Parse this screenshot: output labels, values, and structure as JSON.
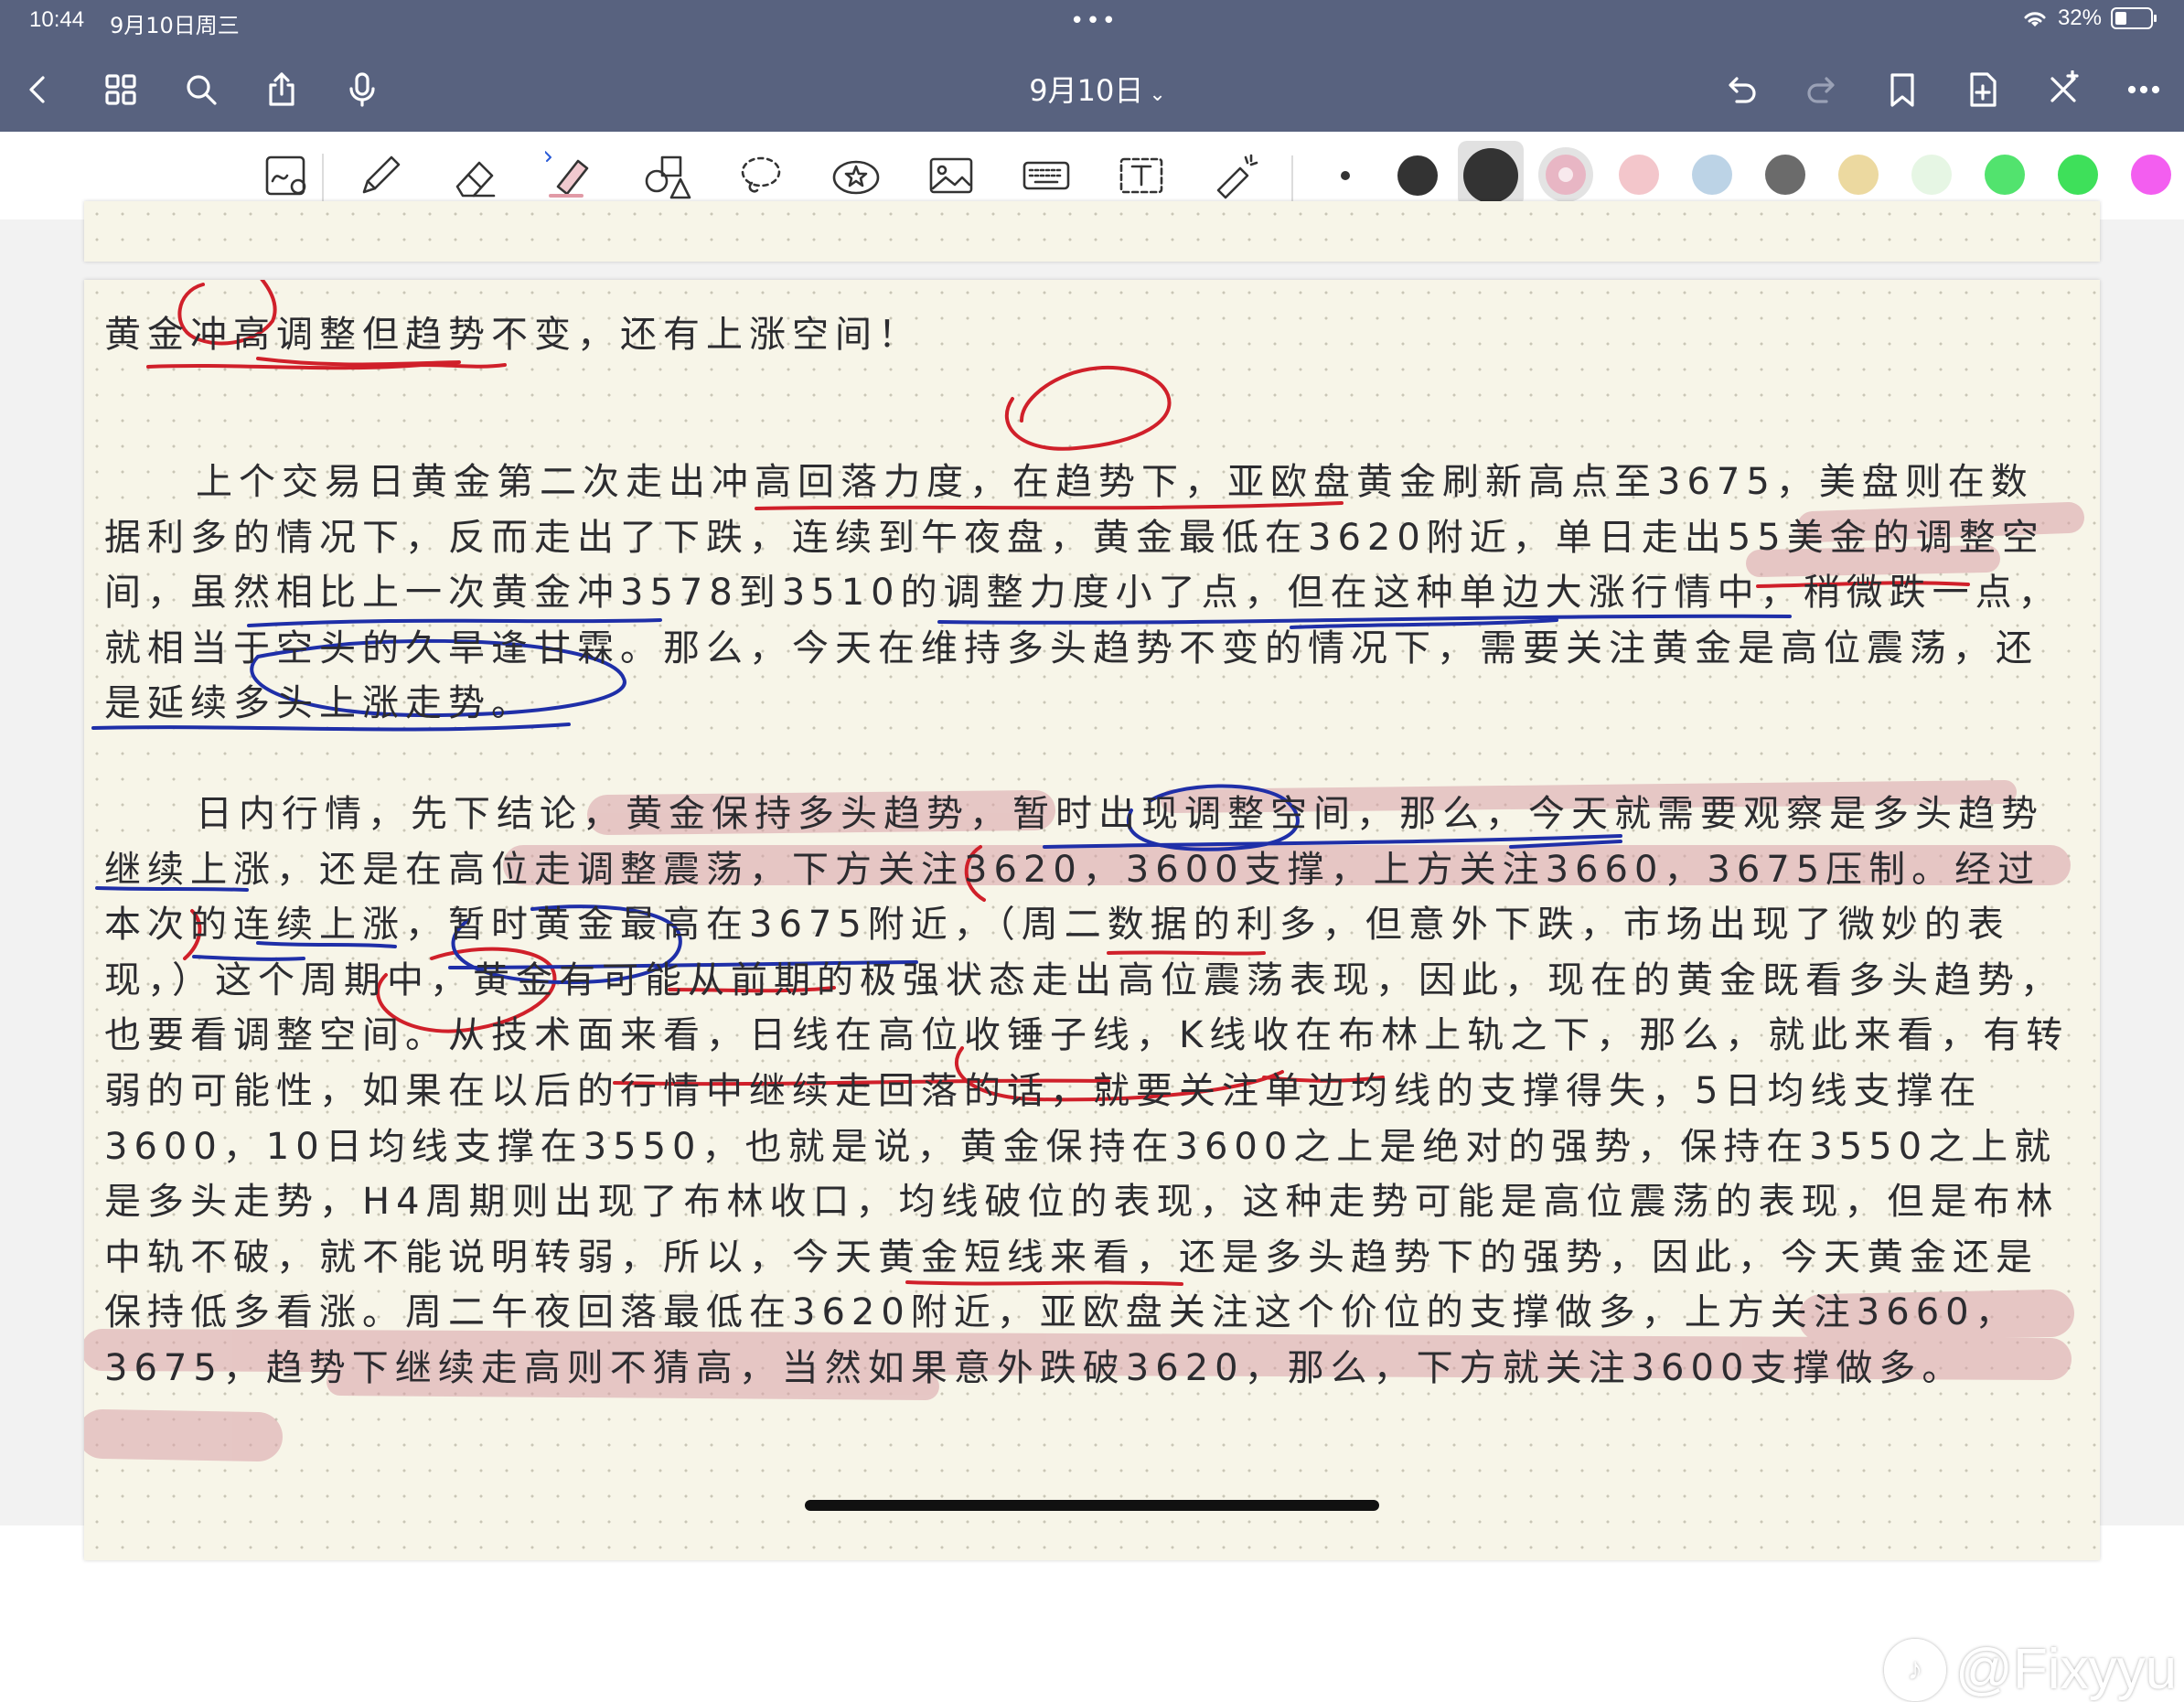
{
  "status_bar": {
    "time": "10:44",
    "date": "9月10日周三",
    "battery": "32%",
    "battery_level": 0.32,
    "multitask_dots": "•••"
  },
  "nav": {
    "title": "9月10日",
    "buttons": [
      "back-icon",
      "grid-icon",
      "search-icon",
      "share-icon",
      "microphone-icon",
      "undo-icon",
      "redo-icon",
      "bookmark-icon",
      "add-page-icon",
      "close-toolbar-icon",
      "more-icon"
    ]
  },
  "toolbar": {
    "tools": [
      "lasso-ai-icon",
      "pen-icon",
      "eraser-icon",
      "highlighter-icon",
      "shapes-icon",
      "lasso-icon",
      "sticker-icon",
      "image-icon",
      "keyboard-icon",
      "text-box-icon",
      "laser-pointer-icon"
    ],
    "stroke_sizes": [
      "small",
      "medium",
      "large"
    ],
    "selected_size": "large",
    "colors": [
      "#e8b6c4",
      "#f3c6cb",
      "#bcd3e6",
      "#6b6b6b",
      "#ecd9a0",
      "#e6f6e4",
      "#52e36e",
      "#3ee05a",
      "#f35ef0"
    ],
    "selected_color": "#e8b6c4"
  },
  "note": {
    "heading": "黄金冲高调整但趋势不变，还有上涨空间！",
    "paragraph1": "上个交易日黄金第二次走出冲高回落力度，在趋势下，亚欧盘黄金刷新高点至3675，美盘则在数据利多的情况下，反而走出了下跌，连续到午夜盘，黄金最低在3620附近，单日走出55美金的调整空间，虽然相比上一次黄金冲3578到3510的调整力度小了点，但在这种单边大涨行情中，稍微跌一点，就相当于空头的久旱逢甘霖。那么，今天在维持多头趋势不变的情况下，需要关注黄金是高位震荡，还是延续多头上涨走势。",
    "paragraph2": "日内行情，先下结论，黄金保持多头趋势，暂时出现调整空间，那么，今天就需要观察是多头趋势继续上涨，还是在高位走调整震荡，下方关注3620，3600支撑，上方关注3660，3675压制。经过本次的连续上涨，暂时黄金最高在3675附近，（周二数据的利多，但意外下跌，市场出现了微妙的表现，）这个周期中，黄金有可能从前期的极强状态走出高位震荡表现，因此，现在的黄金既看多头趋势，也要看调整空间。从技术面来看，日线在高位收锤子线，K线收在布林上轨之下，那么，就此来看，有转弱的可能性，如果在以后的行情中继续走回落的话，就要关注单边均线的支撑得失，5日均线支撑在3600，10日均线支撑在3550，也就是说，黄金保持在3600之上是绝对的强势，保持在3550之上就是多头走势，H4周期则出现了布林收口，均线破位的表现，这种走势可能是高位震荡的表现，但是布林中轨不破，就不能说明转弱，所以，今天黄金短线来看，还是多头趋势下的强势，因此，今天黄金还是保持低多看涨。周二午夜回落最低在3620附近，亚欧盘关注这个价位的支撑做多，上方关注3660，3675，趋势下继续走高则不猜高，当然如果意外跌破3620，那么，下方就关注3600支撑做多。"
  },
  "annotation_colors": {
    "red_pen": "#d0202a",
    "blue_pen": "#1f2fa8",
    "pink_highlight": "#d9a1a8"
  },
  "watermark": "@Fixyyu"
}
